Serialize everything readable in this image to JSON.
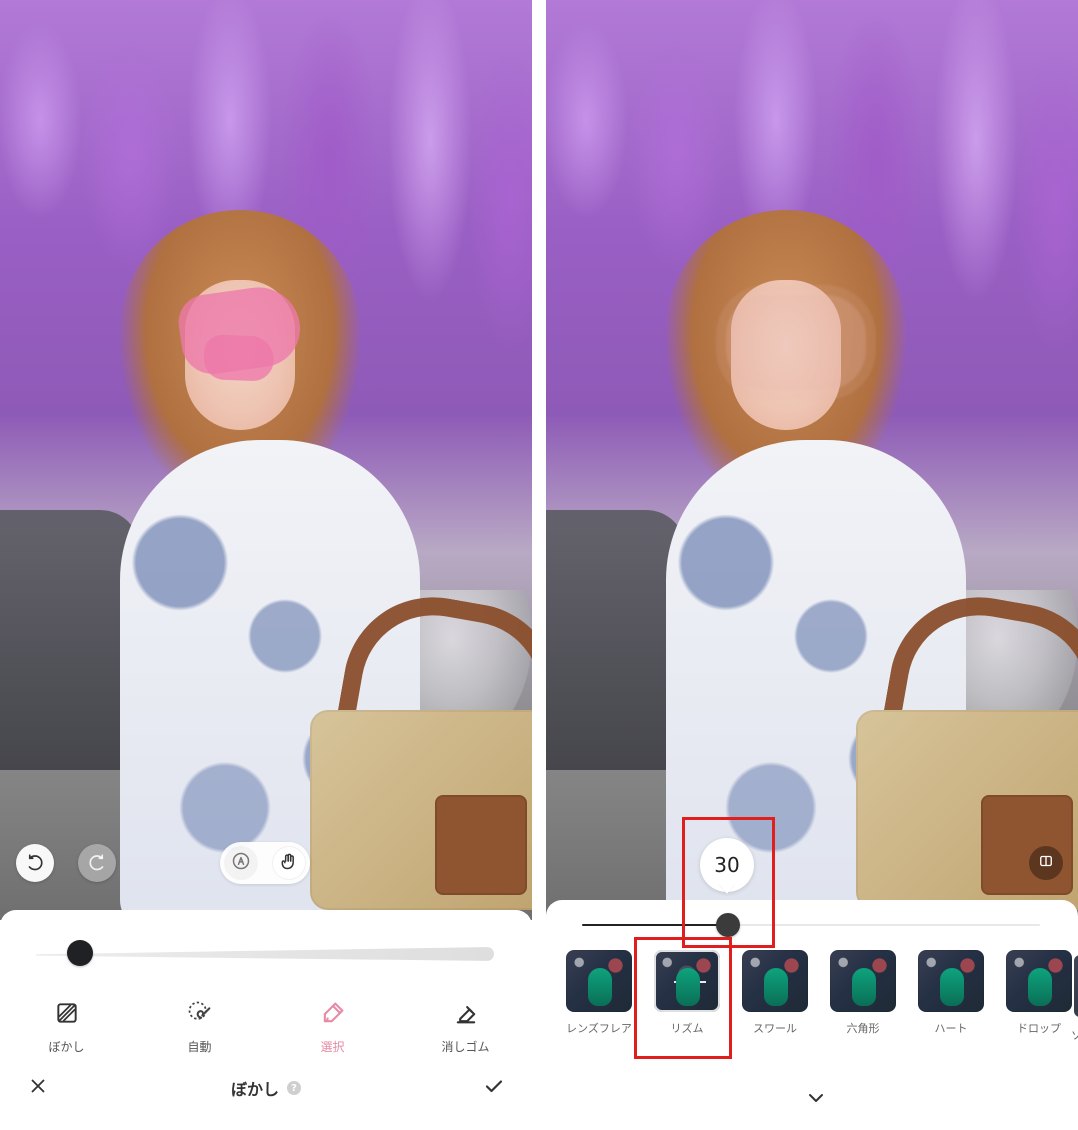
{
  "left": {
    "title": "ぼかし",
    "help": "?",
    "tools": [
      {
        "label": "ぼかし",
        "icon": "hatch-square-icon"
      },
      {
        "label": "自動",
        "icon": "auto-brush-icon"
      },
      {
        "label": "選択",
        "icon": "select-brush-icon"
      },
      {
        "label": "消しゴム",
        "icon": "eraser-icon"
      }
    ],
    "slider": {
      "value_fraction": 0.1
    }
  },
  "right": {
    "slider": {
      "value": 30
    },
    "effects": [
      {
        "label": "レンズフレア"
      },
      {
        "label": "リズム",
        "selected": true
      },
      {
        "label": "スワール"
      },
      {
        "label": "六角形"
      },
      {
        "label": "ハート"
      },
      {
        "label": "ドロップ"
      }
    ],
    "partial_effect_label": "ソ"
  },
  "colors": {
    "active_pink": "#E88AA6",
    "highlight_red": "#E01E1E"
  }
}
